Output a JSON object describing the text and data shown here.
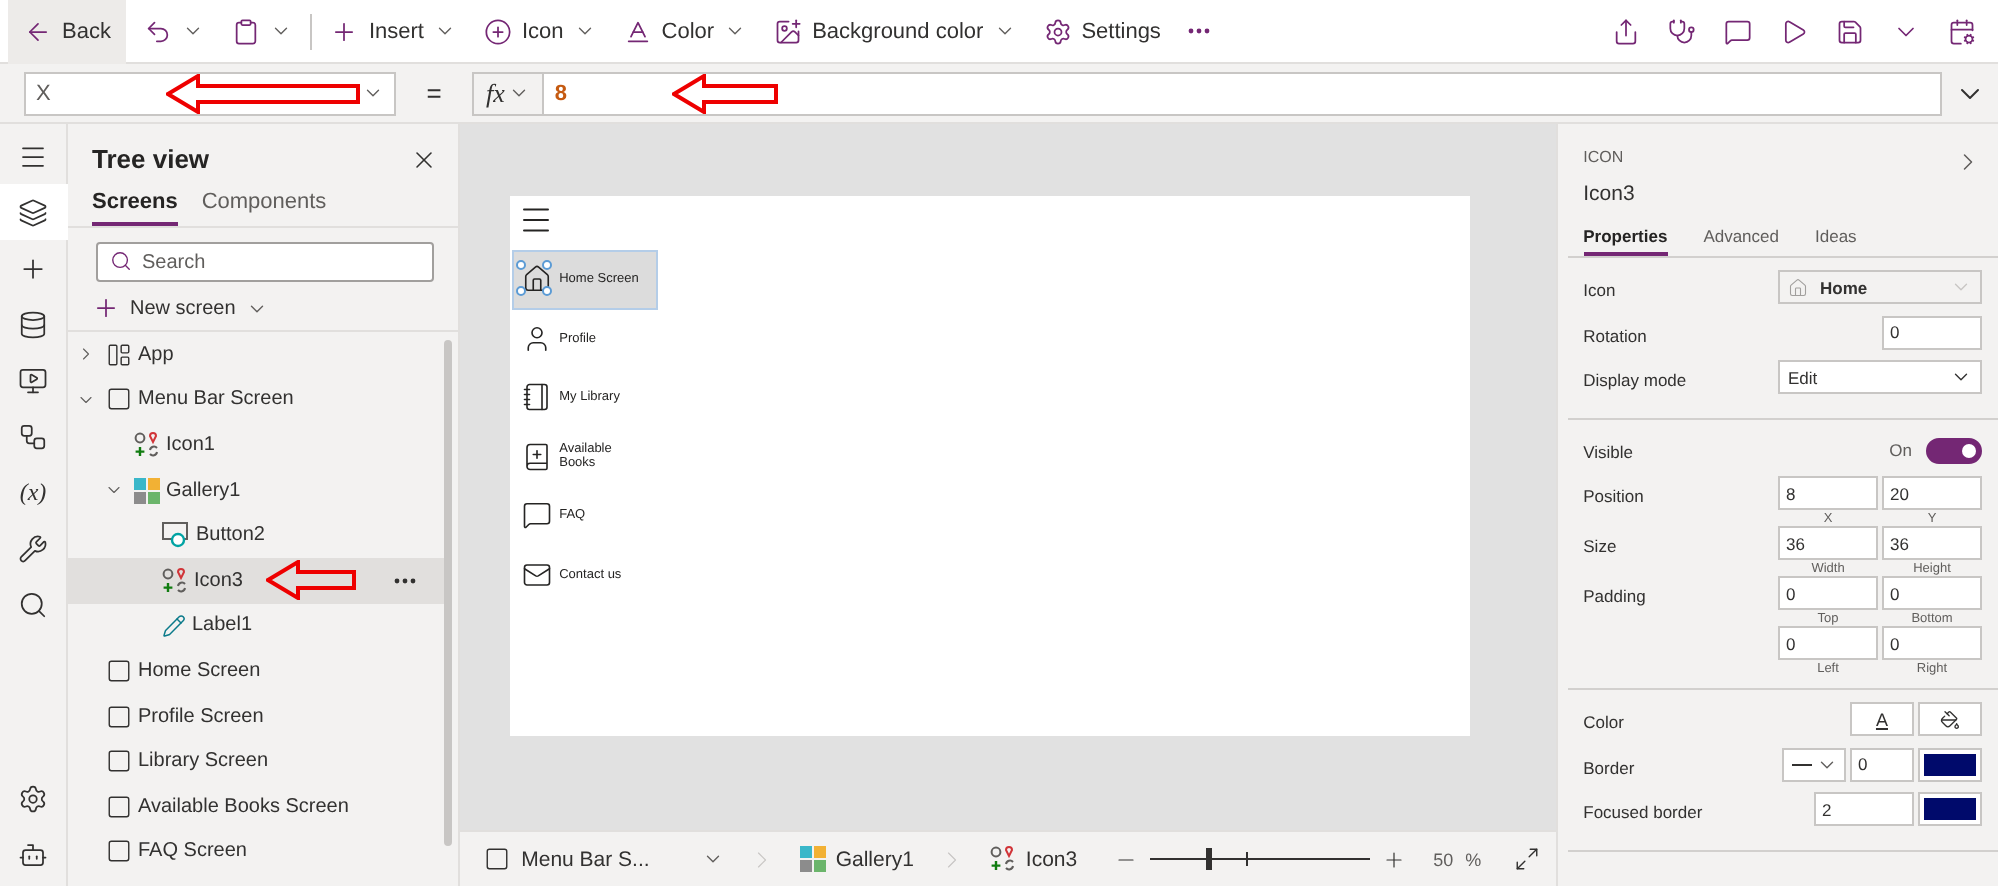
{
  "toolbar": {
    "back": "Back",
    "actions": [
      {
        "kind": "undo"
      },
      {
        "kind": "paste"
      },
      {
        "kind": "insert",
        "label": "Insert"
      },
      {
        "kind": "icon",
        "label": "Icon"
      },
      {
        "kind": "color",
        "label": "Color"
      },
      {
        "kind": "background",
        "label": "Background color"
      },
      {
        "kind": "settings",
        "label": "Settings"
      },
      {
        "kind": "more"
      }
    ],
    "right": [
      {
        "kind": "share"
      },
      {
        "kind": "checker"
      },
      {
        "kind": "comment"
      },
      {
        "kind": "play"
      },
      {
        "kind": "save"
      },
      {
        "kind": "caret"
      },
      {
        "kind": "publish"
      }
    ]
  },
  "formula_bar": {
    "property": "X",
    "equals": "=",
    "fx": "fx",
    "formula": "8"
  },
  "rail": [
    {
      "kind": "menu",
      "selected": false
    },
    {
      "kind": "tree",
      "selected": true
    },
    {
      "kind": "insert",
      "selected": false
    },
    {
      "kind": "data",
      "selected": false
    },
    {
      "kind": "media",
      "selected": false
    },
    {
      "kind": "flows",
      "selected": false
    },
    {
      "kind": "variables",
      "label": "(x)",
      "selected": false
    },
    {
      "kind": "tools",
      "selected": false
    },
    {
      "kind": "search",
      "selected": false
    },
    {
      "kind": "settings",
      "selected": false
    },
    {
      "kind": "agent",
      "selected": false
    }
  ],
  "tree": {
    "title": "Tree view",
    "tabs": [
      {
        "label": "Screens",
        "selected": true
      },
      {
        "label": "Components",
        "selected": false
      }
    ],
    "search": {
      "placeholder": "Search"
    },
    "new_screen": "New screen",
    "items": [
      {
        "kind": "app",
        "label": "App",
        "expanded": false,
        "selected": false
      },
      {
        "kind": "screen",
        "label": "Menu Bar Screen",
        "expanded": true,
        "selected": false,
        "children": [
          {
            "kind": "icon",
            "label": "Icon1",
            "selected": false
          },
          {
            "kind": "gallery",
            "label": "Gallery1",
            "expanded": true,
            "selected": false,
            "children": [
              {
                "kind": "button",
                "label": "Button2",
                "selected": false
              },
              {
                "kind": "icon",
                "label": "Icon3",
                "selected": true
              },
              {
                "kind": "label",
                "label": "Label1",
                "selected": false
              }
            ]
          }
        ]
      },
      {
        "kind": "screen",
        "label": "Home Screen",
        "selected": false
      },
      {
        "kind": "screen",
        "label": "Profile Screen",
        "selected": false
      },
      {
        "kind": "screen",
        "label": "Library Screen",
        "selected": false
      },
      {
        "kind": "screen",
        "label": "Available Books Screen",
        "selected": false
      },
      {
        "kind": "screen",
        "label": "FAQ Screen",
        "selected": false
      }
    ]
  },
  "canvas": {
    "menu": [
      {
        "kind": "home",
        "label": "Home Screen",
        "selected": true
      },
      {
        "kind": "profile",
        "label": "Profile",
        "selected": false
      },
      {
        "kind": "library",
        "label": "My Library",
        "selected": false
      },
      {
        "kind": "books",
        "label": "Available Books",
        "selected": false
      },
      {
        "kind": "faq",
        "label": "FAQ",
        "selected": false
      },
      {
        "kind": "contact",
        "label": "Contact us",
        "selected": false
      }
    ]
  },
  "status_bar": {
    "screen": "Menu Bar S...",
    "crumbs": [
      {
        "kind": "gallery",
        "label": "Gallery1"
      },
      {
        "kind": "icon",
        "label": "Icon3"
      }
    ],
    "zoom": {
      "level": 0.26,
      "value": "50",
      "unit": "%"
    }
  },
  "properties": {
    "type": "ICON",
    "name": "Icon3",
    "tabs": [
      {
        "label": "Properties",
        "selected": true
      },
      {
        "label": "Advanced",
        "selected": false
      },
      {
        "label": "Ideas",
        "selected": false
      }
    ],
    "sections": [
      [
        {
          "kind": "icon_picker",
          "label": "Icon",
          "value": "Home",
          "disabled": true
        },
        {
          "kind": "input",
          "label": "Rotation",
          "value": "0"
        },
        {
          "kind": "dropdown",
          "label": "Display mode",
          "value": "Edit",
          "disabled": false
        }
      ],
      [
        {
          "kind": "toggle",
          "label": "Visible",
          "value": "On",
          "on": true
        },
        {
          "kind": "pair",
          "label": "Position",
          "fields": [
            {
              "value": "8",
              "caption": "X"
            },
            {
              "value": "20",
              "caption": "Y"
            }
          ]
        },
        {
          "kind": "pair",
          "label": "Size",
          "fields": [
            {
              "value": "36",
              "caption": "Width"
            },
            {
              "value": "36",
              "caption": "Height"
            }
          ]
        },
        {
          "kind": "pair",
          "label": "Padding",
          "fields": [
            {
              "value": "0",
              "caption": "Top"
            },
            {
              "value": "0",
              "caption": "Bottom"
            }
          ]
        },
        {
          "kind": "pair",
          "fields": [
            {
              "value": "0",
              "caption": "Left"
            },
            {
              "value": "0",
              "caption": "Right"
            }
          ]
        }
      ],
      [
        {
          "kind": "colors",
          "label": "Color",
          "glyph": "A"
        },
        {
          "kind": "border",
          "label": "Border",
          "value": "0",
          "color": "#000a6b"
        },
        {
          "kind": "focused",
          "label": "Focused border",
          "value": "2",
          "color": "#000a6b"
        }
      ]
    ]
  }
}
